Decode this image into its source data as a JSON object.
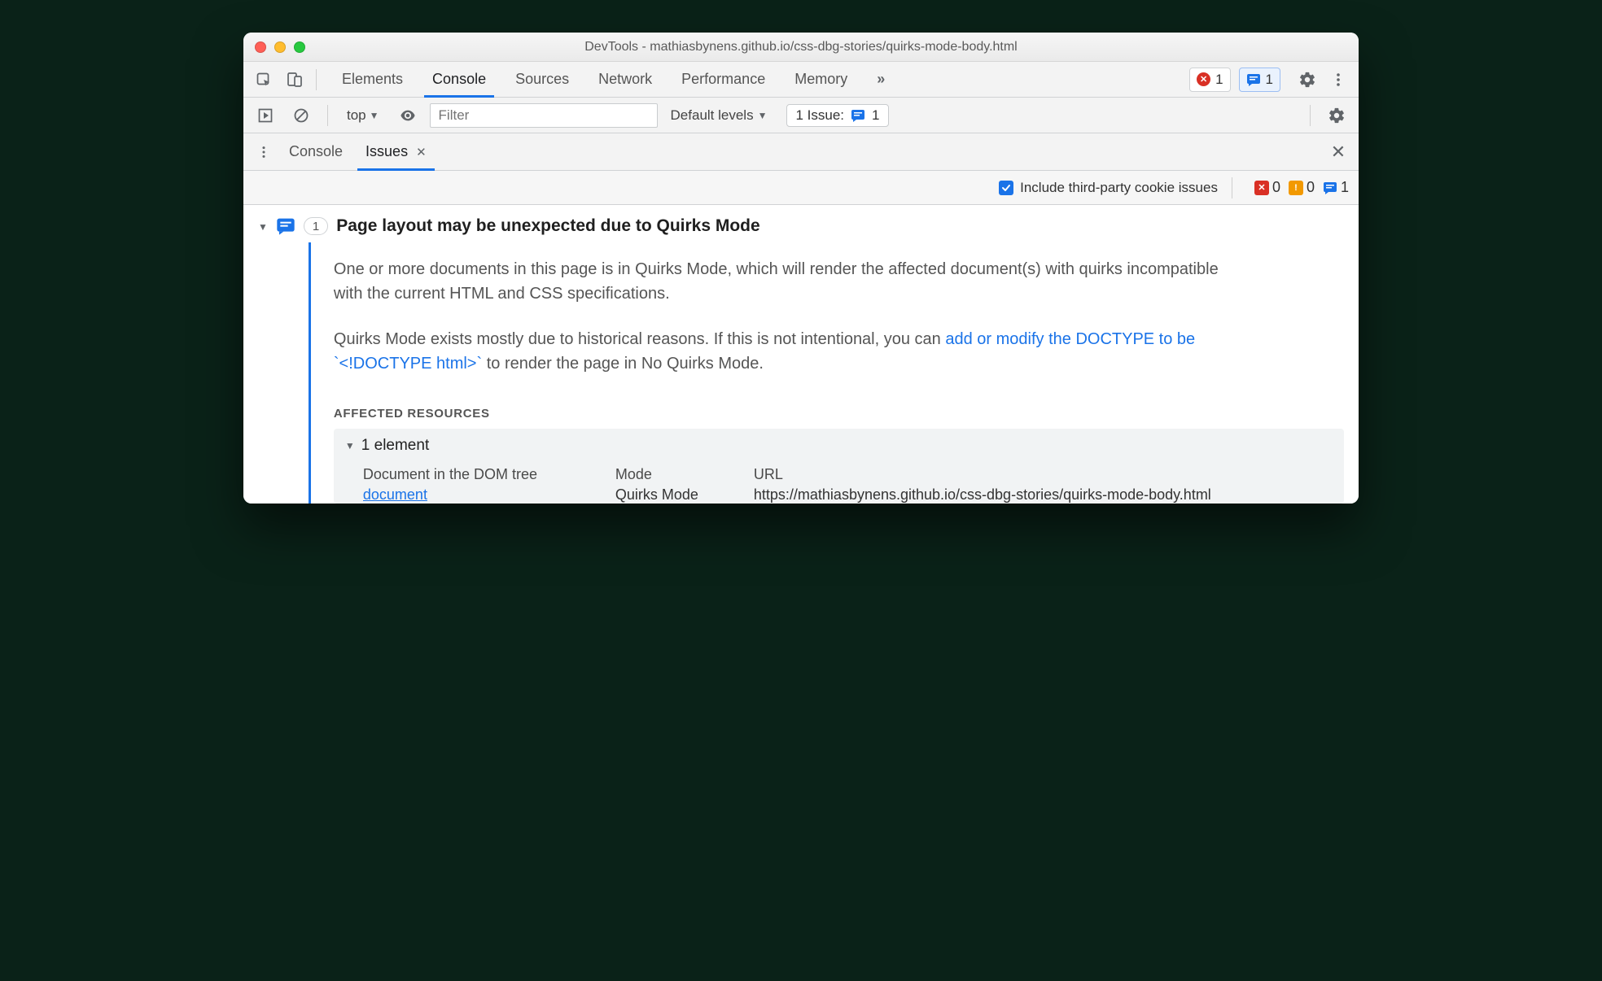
{
  "window": {
    "title": "DevTools - mathiasbynens.github.io/css-dbg-stories/quirks-mode-body.html"
  },
  "tabs": {
    "list": [
      "Elements",
      "Console",
      "Sources",
      "Network",
      "Performance",
      "Memory"
    ],
    "active": "Console",
    "errors": 1,
    "issues_top": 1
  },
  "console_bar": {
    "context": "top",
    "filter_placeholder": "Filter",
    "levels": "Default levels",
    "issue_label": "1 Issue:",
    "issue_count": 1
  },
  "drawer": {
    "tabs": [
      "Console",
      "Issues"
    ],
    "active": "Issues",
    "third_party_label": "Include third-party cookie issues",
    "third_party_checked": true,
    "counts": {
      "errors": 0,
      "warnings": 0,
      "info": 1
    }
  },
  "issue": {
    "count": 1,
    "title": "Page layout may be unexpected due to Quirks Mode",
    "p1": "One or more documents in this page is in Quirks Mode, which will render the affected document(s) with quirks incompatible with the current HTML and CSS specifications.",
    "p2_a": "Quirks Mode exists mostly due to historical reasons. If this is not intentional, you can ",
    "p2_link": "add or modify the DOCTYPE to be `<!DOCTYPE html>`",
    "p2_b": " to render the page in No Quirks Mode.",
    "affected_label": "Affected Resources",
    "element_count": "1 element",
    "cols": {
      "c1": "Document in the DOM tree",
      "c2": "Mode",
      "c3": "URL"
    },
    "row": {
      "doc": "document",
      "mode": "Quirks Mode",
      "url": "https://mathiasbynens.github.io/css-dbg-stories/quirks-mode-body.html"
    }
  }
}
